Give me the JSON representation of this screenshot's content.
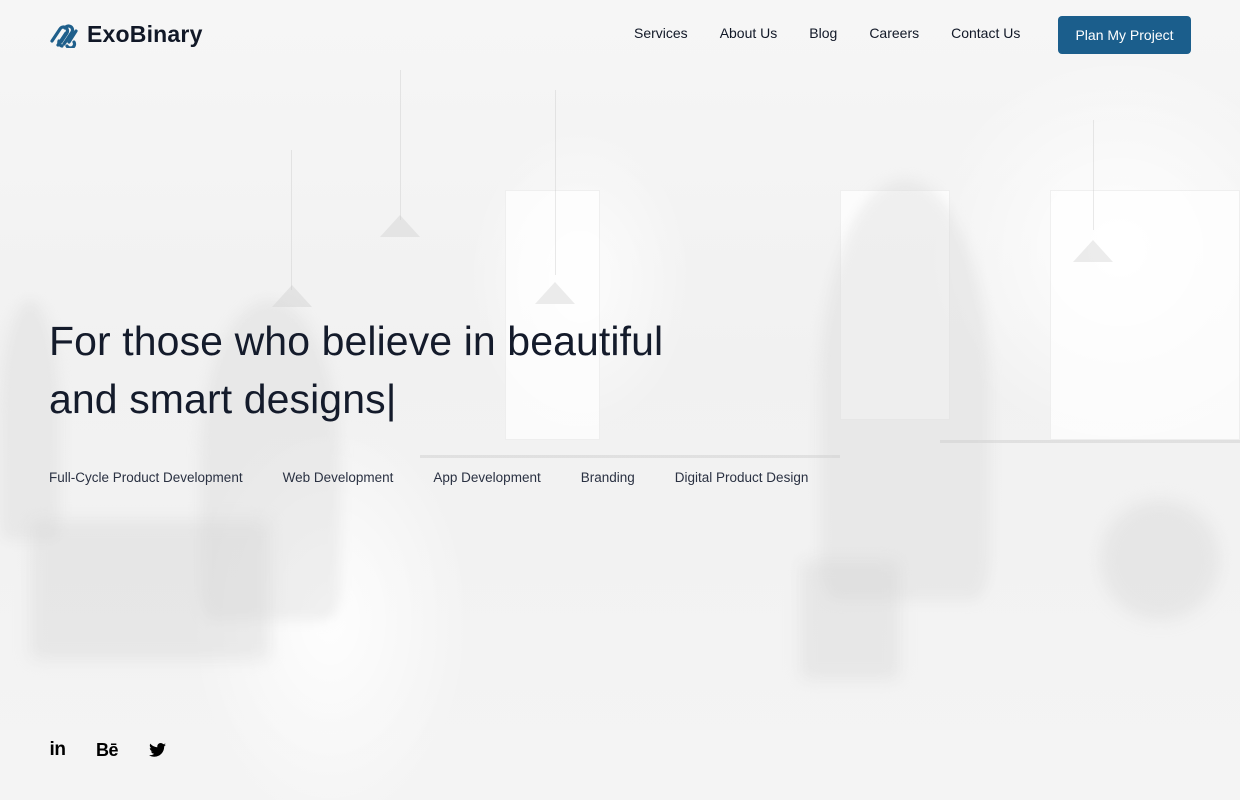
{
  "brand": {
    "name": "ExoBinary",
    "logo_icon": "paperclip-wave-logo-icon",
    "accent_color": "#1b5e8c",
    "logo_color": "#1f5f8b"
  },
  "nav": {
    "items": [
      {
        "label": "Services"
      },
      {
        "label": "About Us"
      },
      {
        "label": "Blog"
      },
      {
        "label": "Careers"
      },
      {
        "label": "Contact Us"
      }
    ],
    "cta_label": "Plan My Project"
  },
  "hero": {
    "title_line1": "For those who believe in beautiful",
    "title_line2": "and smart designs",
    "caret": "|",
    "services": [
      {
        "label": "Full-Cycle Product Development"
      },
      {
        "label": "Web Development"
      },
      {
        "label": "App Development"
      },
      {
        "label": "Branding"
      },
      {
        "label": "Digital Product Design"
      }
    ]
  },
  "socials": [
    {
      "name": "linkedin",
      "glyph": "in",
      "icon": "linkedin-icon"
    },
    {
      "name": "behance",
      "glyph": "Bē",
      "icon": "behance-icon"
    },
    {
      "name": "twitter",
      "glyph": "",
      "icon": "twitter-icon"
    }
  ]
}
